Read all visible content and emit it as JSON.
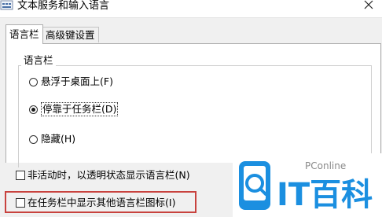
{
  "window": {
    "title": "文本服务和输入语言"
  },
  "tabs": [
    {
      "label": "语言栏",
      "active": true
    },
    {
      "label": "高级键设置",
      "active": false
    }
  ],
  "language_bar_group": {
    "label": "语言栏",
    "options": [
      {
        "label": "悬浮于桌面上(F)",
        "checked": false
      },
      {
        "label": "停靠于任务栏(D)",
        "checked": true
      },
      {
        "label": "隐藏(H)",
        "checked": false
      }
    ]
  },
  "checkboxes": [
    {
      "label": "非活动时，以透明状态显示语言栏(N)",
      "checked": false
    },
    {
      "label": "在任务栏中显示其他语言栏图标(I)",
      "checked": false
    }
  ],
  "watermark": {
    "brand": "PConline",
    "logo_text": "IT百科",
    "colors": {
      "accent": "#1b8fe0",
      "frame": "#c8423e"
    }
  }
}
